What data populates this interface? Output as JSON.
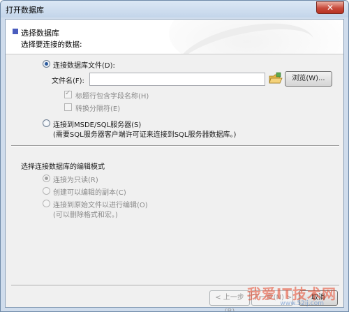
{
  "window": {
    "title": "打开数据库",
    "close_glyph": "✕"
  },
  "header": {
    "title": "选择数据库",
    "subtitle": "选择要连接的数据:"
  },
  "source": {
    "file_option_label": "连接数据库文件(D):",
    "file_name_label": "文件名(F):",
    "file_name_value": "",
    "browse_label": "浏览(W)...",
    "header_row_label": "标题行包含字段名称(H)",
    "convert_sep_label": "转换分隔符(E)",
    "server_option_label": "连接到MSDE/SQL服务器(S)",
    "server_note": "(需要SQL服务器客户端许可证来连接到SQL服务器数据库。)"
  },
  "mode": {
    "section_title": "选择连接数据库的编辑模式",
    "readonly_label": "连接为只读(R)",
    "copy_label": "创建可以编辑的副本(C)",
    "original_label": "连接到原始文件以进行编辑(O)",
    "original_note": "(可以删除格式和宏。)"
  },
  "footer": {
    "back_label": "< 上一步(B)",
    "next_label": "下一步(N) >",
    "cancel_label": "取消"
  },
  "watermark": {
    "text": "我爱IT技术网",
    "url": "www.52ij.com"
  },
  "colors": {
    "accent": "#4a5dbe",
    "radio_dot": "#2a5a9e",
    "close": "#c7493a"
  }
}
